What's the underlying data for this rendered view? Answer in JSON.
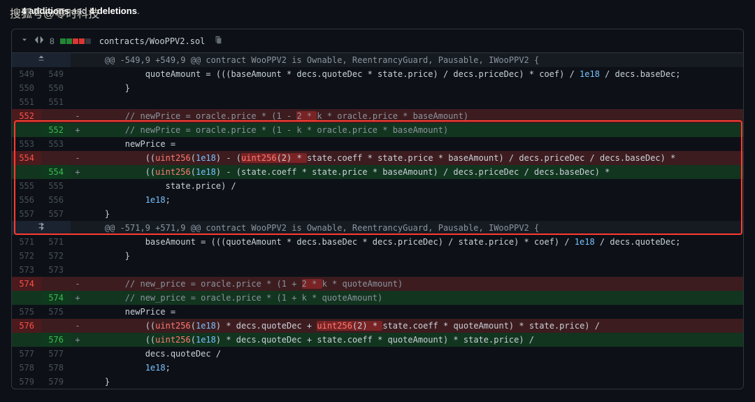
{
  "watermark": "搜狐号@零时科技",
  "summary": {
    "prefix": "...",
    "count": "4 additions",
    "and": " and ",
    "del": "4 deletions",
    "suffix": "."
  },
  "file": {
    "stat": "8",
    "path": "contracts/WooPPV2.sol"
  },
  "hunks": [
    {
      "expand": "up",
      "header": "@@ -549,9 +549,9 @@ contract WooPPV2 is Ownable, ReentrancyGuard, Pausable, IWooPPV2 {",
      "lines": [
        {
          "t": "ctx",
          "o": "549",
          "n": "549",
          "code": "            quoteAmount = (((baseAmount * decs.quoteDec * state.price) / decs.priceDec) * coef) / 1e18 / decs.baseDec;"
        },
        {
          "t": "ctx",
          "o": "550",
          "n": "550",
          "code": "        }"
        },
        {
          "t": "ctx",
          "o": "551",
          "n": "551",
          "code": ""
        },
        {
          "t": "del",
          "o": "552",
          "n": "",
          "code": "        // newPrice = oracle.price * (1 - ",
          "hl": "2 * ",
          "code2": "k * oracle.price * baseAmount)"
        },
        {
          "t": "add",
          "o": "",
          "n": "552",
          "code": "        // newPrice = oracle.price * (1 - k * oracle.price * baseAmount)"
        },
        {
          "t": "ctx",
          "o": "553",
          "n": "553",
          "code": "        newPrice ="
        },
        {
          "t": "del",
          "o": "554",
          "n": "",
          "code": "            ((uint256(1e18) - (",
          "hl": "uint256(2) * ",
          "code2": "state.coeff * state.price * baseAmount) / decs.priceDec / decs.baseDec) *"
        },
        {
          "t": "add",
          "o": "",
          "n": "554",
          "code": "            ((uint256(1e18) - (state.coeff * state.price * baseAmount) / decs.priceDec / decs.baseDec) *"
        },
        {
          "t": "ctx",
          "o": "555",
          "n": "555",
          "code": "                state.price) /"
        },
        {
          "t": "ctx",
          "o": "556",
          "n": "556",
          "code": "            1e18;"
        },
        {
          "t": "ctx",
          "o": "557",
          "n": "557",
          "code": "    }"
        }
      ]
    },
    {
      "expand": "both",
      "header": "@@ -571,9 +571,9 @@ contract WooPPV2 is Ownable, ReentrancyGuard, Pausable, IWooPPV2 {",
      "lines": [
        {
          "t": "ctx",
          "o": "571",
          "n": "571",
          "code": "            baseAmount = (((quoteAmount * decs.baseDec * decs.priceDec) / state.price) * coef) / 1e18 / decs.quoteDec;"
        },
        {
          "t": "ctx",
          "o": "572",
          "n": "572",
          "code": "        }"
        },
        {
          "t": "ctx",
          "o": "573",
          "n": "573",
          "code": ""
        },
        {
          "t": "del",
          "o": "574",
          "n": "",
          "code": "        // new_price = oracle.price * (1 + ",
          "hl": "2 * ",
          "code2": "k * quoteAmount)"
        },
        {
          "t": "add",
          "o": "",
          "n": "574",
          "code": "        // new_price = oracle.price * (1 + k * quoteAmount)"
        },
        {
          "t": "ctx",
          "o": "575",
          "n": "575",
          "code": "        newPrice ="
        },
        {
          "t": "del",
          "o": "576",
          "n": "",
          "code": "            ((uint256(1e18) * decs.quoteDec + ",
          "hl": "uint256(2) * ",
          "code2": "state.coeff * quoteAmount) * state.price) /"
        },
        {
          "t": "add",
          "o": "",
          "n": "576",
          "code": "            ((uint256(1e18) * decs.quoteDec + state.coeff * quoteAmount) * state.price) /"
        },
        {
          "t": "ctx",
          "o": "577",
          "n": "577",
          "code": "            decs.quoteDec /"
        },
        {
          "t": "ctx",
          "o": "578",
          "n": "578",
          "code": "            1e18;"
        },
        {
          "t": "ctx",
          "o": "579",
          "n": "579",
          "code": "    }"
        }
      ]
    }
  ]
}
